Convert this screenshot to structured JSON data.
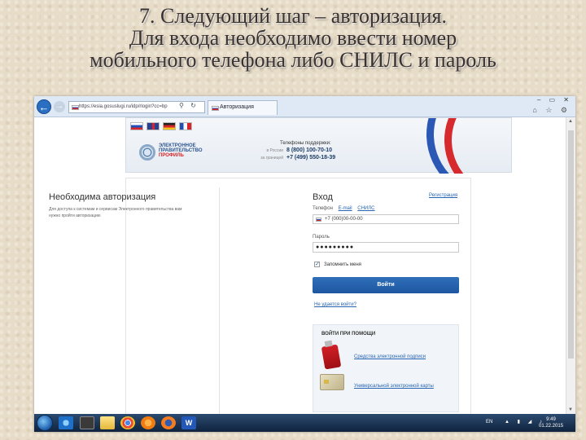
{
  "slide": {
    "title_line1": "7. Следующий шаг – авторизация.",
    "title_line2": "Для входа необходимо ввести номер",
    "title_line3": "мобильного телефона либо СНИЛС и пароль"
  },
  "browser": {
    "address": "https://esia.gosuslugi.ru/idp/rlogin?cc=bp",
    "tab_title": "Авторизация",
    "window_controls": "‒ ▭ ✕",
    "right_icons": "⌂ ☆ ⚙"
  },
  "header": {
    "languages": [
      "ru",
      "en",
      "de",
      "fr"
    ],
    "logo_line1": "ЭЛЕКТРОННОЕ",
    "logo_line2": "ПРАВИТЕЛЬСТВО",
    "logo_line3": "ПРОФИЛЬ",
    "support_title": "Телефоны поддержки:",
    "support_russia_label": "в России",
    "support_russia_number": "8 (800) 100-70-10",
    "support_abroad_label": "за границей",
    "support_abroad_number": "+7 (499) 550-18-39"
  },
  "left": {
    "title": "Необходима авторизация",
    "description": "Для доступа к системам и сервисам Электронного правительства вам нужно пройти авторизацию"
  },
  "login": {
    "title": "Вход",
    "register_link": "Регистрация",
    "method_label": "Телефон",
    "method_email": "E-mail",
    "method_snils": "СНИЛС",
    "phone_value": "+7 (000)00-00-00",
    "password_label": "Пароль",
    "password_value": "●●●●●●●●●",
    "remember_label": "Запомнить меня",
    "remember_checked": "✓",
    "submit_label": "Войти",
    "forgot_link": "Не удается войти?",
    "alt_title": "ВОЙТИ ПРИ ПОМОЩИ",
    "alt_option1": "Средства электронной подписи",
    "alt_option2": "Универсальной электронной карты"
  },
  "taskbar": {
    "word_letter": "W",
    "language": "EN",
    "tray_icons": "▲ ▮ ◢ ♪",
    "time": "9:49",
    "date": "01.22.2015"
  },
  "colors": {
    "accent_blue": "#1e56a1",
    "link_blue": "#2866b3",
    "brand_red": "#d72a2e",
    "slide_background": "#e7dcc8"
  }
}
